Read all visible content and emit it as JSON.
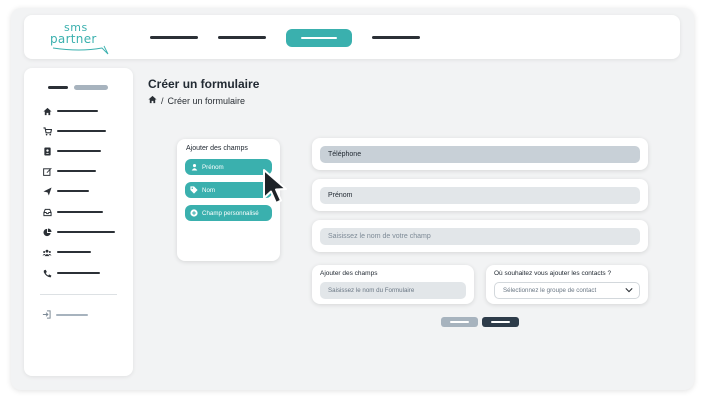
{
  "app": {
    "logo_line1": "sms",
    "logo_line2": "partner",
    "accent_color": "#3ab0ae",
    "dark_color": "#2e3c4a"
  },
  "page": {
    "title": "Créer un formulaire",
    "breadcrumb_current": "Créer un formulaire",
    "breadcrumb_separator": "/"
  },
  "sidebar": {
    "icons": [
      "home-icon",
      "cart-icon",
      "contacts-icon",
      "edit-icon",
      "send-icon",
      "inbox-icon",
      "pie-chart-icon",
      "users-icon",
      "phone-icon"
    ],
    "logout_icon": "logout-icon"
  },
  "add_fields": {
    "heading": "Ajouter des champs",
    "items": [
      {
        "label": "Prénom",
        "icon": "user-icon"
      },
      {
        "label": "Nom",
        "icon": "tag-icon"
      },
      {
        "label": "Champ personnalisé",
        "icon": "plus-circle-icon"
      }
    ]
  },
  "form_fields": [
    {
      "value": "Téléphone"
    },
    {
      "value": "Prénom"
    },
    {
      "placeholder": "Saisissez le nom de votre champ"
    }
  ],
  "form_name": {
    "heading": "Ajouter des champs",
    "placeholder": "Saisissez le nom du Formulaire"
  },
  "contact_group": {
    "heading": "Où souhaitez vous ajouter les contacts ?",
    "placeholder": "Sélectionnez le groupe de contact"
  }
}
